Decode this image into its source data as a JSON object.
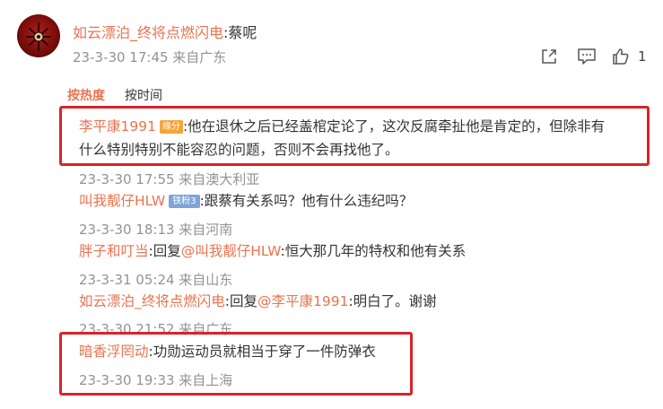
{
  "main_post": {
    "username": "如云漂泊_终将点燃闪电",
    "text": ":蔡呢",
    "meta": "23-3-30 17:45 来自广东",
    "like_count": "1"
  },
  "sort": {
    "hot": "按热度",
    "time": "按时间"
  },
  "comments": [
    {
      "username": "李平康1991",
      "badge": "缘分",
      "line1": ":他在退休之后已经盖棺定论了，这次反腐牵扯他是肯定的，但除非有",
      "line2": "什么特别特别不能容忍的问题，否则不会再找他了。",
      "meta": "23-3-30 17:55 来自澳大利亚"
    },
    {
      "username": "叫我靓仔HLW",
      "badge": "铁粉3",
      "text": ":跟蔡有关系吗？他有什么违纪吗？",
      "meta": "23-3-30 18:13 来自河南"
    },
    {
      "username": "胖子和叮当",
      "reply_prefix": ":回复",
      "reply_to": "@叫我靓仔HLW",
      "text": ":恒大那几年的特权和他有关系",
      "meta": "23-3-31 05:24 来自山东"
    },
    {
      "username": "如云漂泊_终将点燃闪电",
      "reply_prefix": ":回复",
      "reply_to": "@李平康1991",
      "text": ":明白了。谢谢",
      "meta": "23-3-30 21:52 来自广东"
    },
    {
      "username": "暗香浮罔动",
      "text": ":功勋运动员就相当于穿了一件防弹衣",
      "meta": "23-3-30 19:33 来自上海"
    }
  ],
  "icons": {
    "share": "share-icon",
    "comment": "comment-icon",
    "like": "thumbs-up-icon"
  },
  "colors": {
    "username": "#eb7350",
    "meta": "#939393",
    "highlight_box": "#d6252a"
  }
}
